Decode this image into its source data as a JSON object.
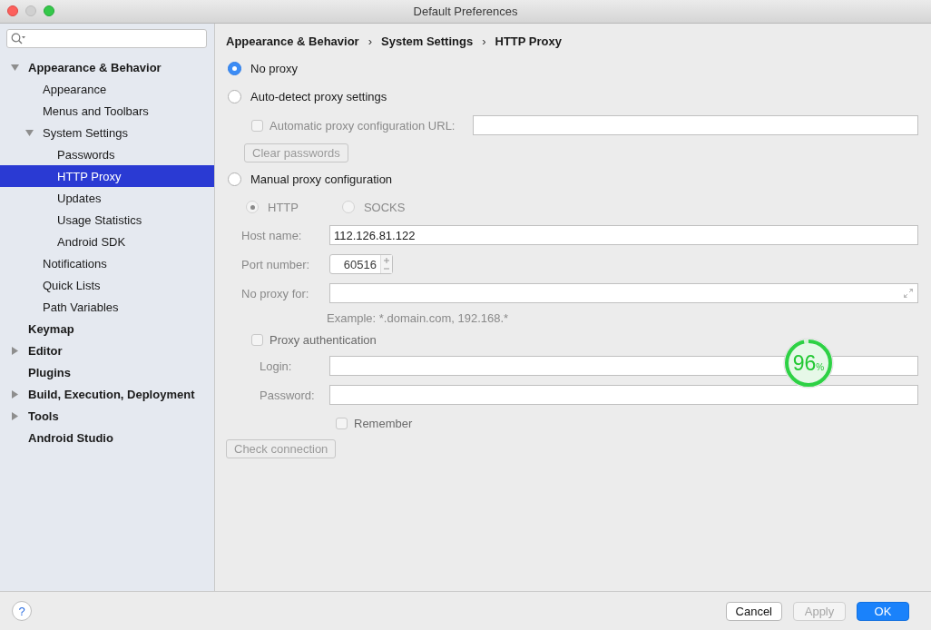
{
  "window": {
    "title": "Default Preferences"
  },
  "sidebar": {
    "items": [
      {
        "label": "Appearance & Behavior",
        "expanded": true,
        "selected": false,
        "children": [
          {
            "label": "Appearance",
            "selected": false
          },
          {
            "label": "Menus and Toolbars",
            "selected": false
          },
          {
            "label": "System Settings",
            "expanded": true,
            "selected": false,
            "children": [
              {
                "label": "Passwords",
                "selected": false
              },
              {
                "label": "HTTP Proxy",
                "selected": true
              },
              {
                "label": "Updates",
                "selected": false
              },
              {
                "label": "Usage Statistics",
                "selected": false
              },
              {
                "label": "Android SDK",
                "selected": false
              }
            ]
          },
          {
            "label": "Notifications",
            "selected": false
          },
          {
            "label": "Quick Lists",
            "selected": false
          },
          {
            "label": "Path Variables",
            "selected": false
          }
        ]
      },
      {
        "label": "Keymap",
        "selected": false
      },
      {
        "label": "Editor",
        "expanded": false,
        "selected": false
      },
      {
        "label": "Plugins",
        "selected": false
      },
      {
        "label": "Build, Execution, Deployment",
        "expanded": false,
        "selected": false
      },
      {
        "label": "Tools",
        "expanded": false,
        "selected": false
      },
      {
        "label": "Android Studio",
        "selected": false
      }
    ]
  },
  "breadcrumb": {
    "items": [
      "Appearance & Behavior",
      "System Settings",
      "HTTP Proxy"
    ],
    "separators": [
      "›",
      "›"
    ]
  },
  "no_proxy": {
    "label": "No proxy",
    "selected": true
  },
  "auto_detect": {
    "label": "Auto-detect proxy settings",
    "selected": false,
    "disabled": true,
    "auto_config_url": {
      "label": "Automatic proxy configuration URL:",
      "checked": false
    },
    "clear_passwords_button": {
      "label": "Clear passwords",
      "disabled": true
    }
  },
  "manual": {
    "label": "Manual proxy configuration",
    "selected": false,
    "disabled": true,
    "protocols": [
      {
        "label": "HTTP",
        "selected": true
      },
      {
        "label": "SOCKS",
        "selected": false
      }
    ],
    "host_name": {
      "label": "Host name:",
      "value": "112.126.81.122"
    },
    "port_number": {
      "label": "Port number:",
      "value": "60516"
    },
    "no_proxy_for": {
      "label": "No proxy for:",
      "hint": "Example: *.domain.com, 192.168.*"
    },
    "proxy_authentication": {
      "label": "Proxy authentication",
      "checked": false
    },
    "login": {
      "label": "Login:"
    },
    "password": {
      "label": "Password:"
    },
    "remember": {
      "label": "Remember",
      "checked": false
    }
  },
  "check_connection_button": {
    "label": "Check connection",
    "disabled": true
  },
  "footer": {
    "help_button": "?",
    "buttons": [
      {
        "label": "Cancel",
        "kind": "normal",
        "disabled": false
      },
      {
        "label": "Apply",
        "kind": "normal",
        "disabled": true
      },
      {
        "label": "OK",
        "kind": "default",
        "disabled": false
      }
    ]
  },
  "speed_widget": {
    "value": "96",
    "unit": "%",
    "level": 0.96
  }
}
